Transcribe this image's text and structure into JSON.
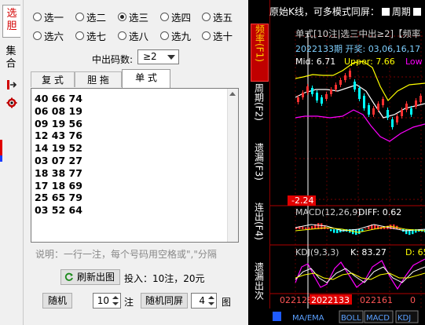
{
  "sidebar": {
    "tabs": [
      {
        "label": "选\n胆",
        "active": true
      },
      {
        "label": "集\n合",
        "active": false
      }
    ],
    "icons": [
      "export-icon",
      "settings-gear-icon"
    ]
  },
  "options": {
    "radios": [
      {
        "label": "选一",
        "checked": false
      },
      {
        "label": "选二",
        "checked": false
      },
      {
        "label": "选三",
        "checked": true
      },
      {
        "label": "选四",
        "checked": false
      },
      {
        "label": "选五",
        "checked": false
      },
      {
        "label": "选六",
        "checked": false
      },
      {
        "label": "选七",
        "checked": false
      },
      {
        "label": "选八",
        "checked": false
      },
      {
        "label": "选九",
        "checked": false
      },
      {
        "label": "选十",
        "checked": false
      }
    ],
    "hit_label": "中出码数:",
    "hit_value": "≥2"
  },
  "tabs": [
    "复 式",
    "胆 拖",
    "单 式"
  ],
  "active_tab": "单 式",
  "bets": [
    "40 66 74",
    "06 08 19",
    "09 19 56",
    "12 43 76",
    "14 19 52",
    "03 07 27",
    "18 38 77",
    "17 18 69",
    "25 65 79",
    "03 52 64"
  ],
  "explain": "说明：一行一注，每个号码用空格或\",\"分隔",
  "actions": {
    "refresh": "刷新出图",
    "invest": "投入：10注，20元",
    "random": "随机",
    "random_count": "10",
    "random_unit": "注",
    "random_screen": "随机同屏",
    "screen_count": "4",
    "screen_unit": "图"
  },
  "chart": {
    "top_bar": {
      "text": "原始K线，可多模式同屏：",
      "cycle_label": "周期"
    },
    "side_tabs": [
      "频率(F1)",
      "周期(F2)",
      "遗漏(F3)",
      "连出(F4)",
      "遗漏出次"
    ],
    "title": "单式[10注|选三中出≥2]【频率",
    "period": "2022133期 开奖: 03,06,16,17",
    "mid": "Mid: 6.71",
    "upper": "Upper: 7.66",
    "lower": "Low",
    "price_tag": "-2.24",
    "macd_label": "MACD(12,26,9)",
    "diff": "DIFF: 0.62",
    "kdj_label": "KDJ(9,3,3)",
    "k": "K: 83.27",
    "d": "D: 65",
    "x_ticks": [
      "022128",
      "2022133",
      "022161",
      "0"
    ],
    "bottom_tabs": [
      "MA/EMA",
      "BOLL",
      "MACD",
      "KDJ"
    ],
    "colors": {
      "up": "#ff3030",
      "down": "#00ffff",
      "mid": "#ffffff",
      "upper": "#ffff00",
      "lower": "#ff00ff",
      "macd_line": "#ffffff"
    }
  }
}
